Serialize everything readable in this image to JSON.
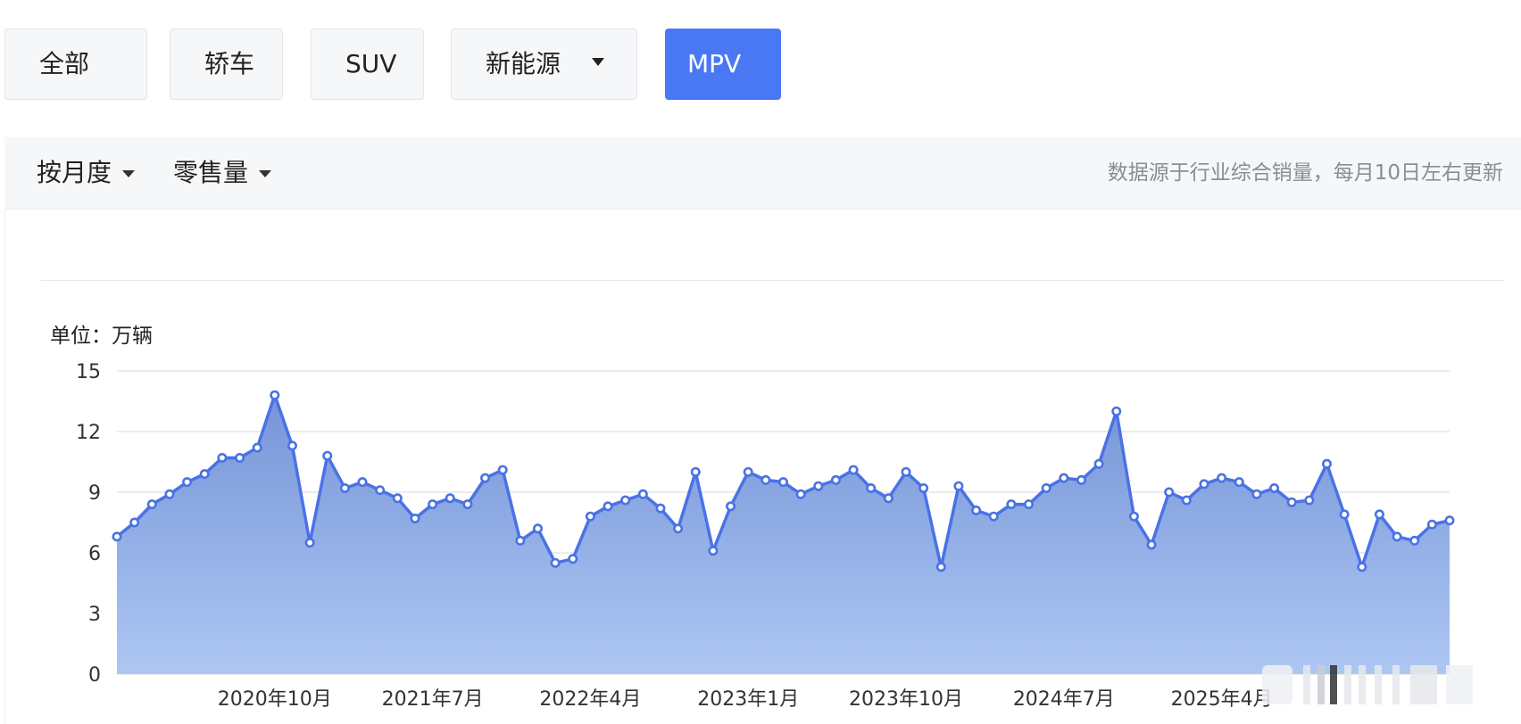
{
  "tabs": [
    {
      "label": "全部",
      "active": false,
      "dropdown": false
    },
    {
      "label": "轿车",
      "active": false,
      "dropdown": false
    },
    {
      "label": "SUV",
      "active": false,
      "dropdown": false
    },
    {
      "label": "新能源",
      "active": false,
      "dropdown": true
    },
    {
      "label": "MPV",
      "active": true,
      "dropdown": false
    }
  ],
  "filters": {
    "period": "按月度",
    "metric": "零售量",
    "source_note": "数据源于行业综合销量，每月10日左右更新"
  },
  "unit_label": "单位：万辆",
  "colors": {
    "accent": "#4a78f5",
    "line": "#4a72e6",
    "tab_bg": "#f6f7f8"
  },
  "chart_data": {
    "type": "area",
    "title": "",
    "xlabel": "",
    "ylabel": "",
    "y_unit": "万辆",
    "ylim": [
      0,
      15
    ],
    "yticks": [
      0,
      3,
      6,
      9,
      12,
      15
    ],
    "grid": true,
    "x_start": "2020年1月",
    "x_labeled_ticks": [
      {
        "index": 9,
        "label": "2020年10月"
      },
      {
        "index": 18,
        "label": "2021年7月"
      },
      {
        "index": 27,
        "label": "2022年4月"
      },
      {
        "index": 36,
        "label": "2023年1月"
      },
      {
        "index": 45,
        "label": "2023年10月"
      },
      {
        "index": 54,
        "label": "2024年7月"
      },
      {
        "index": 63,
        "label": "2025年4月"
      }
    ],
    "series": [
      {
        "name": "",
        "values": [
          6.8,
          7.5,
          8.4,
          8.9,
          9.5,
          9.9,
          10.7,
          10.7,
          11.2,
          13.8,
          11.3,
          6.5,
          10.8,
          9.2,
          9.5,
          9.1,
          8.7,
          7.7,
          8.4,
          8.7,
          8.4,
          9.7,
          10.1,
          6.6,
          7.2,
          5.5,
          5.7,
          7.8,
          8.3,
          8.6,
          8.9,
          8.2,
          7.2,
          10.0,
          6.1,
          8.3,
          10.0,
          9.6,
          9.5,
          8.9,
          9.3,
          9.6,
          10.1,
          9.2,
          8.7,
          10.0,
          9.2,
          5.3,
          9.3,
          8.1,
          7.8,
          8.4,
          8.4,
          9.2,
          9.7,
          9.6,
          10.4,
          13.0,
          7.8,
          6.4,
          9.0,
          8.6,
          9.4,
          9.7,
          9.5,
          8.9,
          9.2,
          8.5,
          8.6,
          10.4,
          7.9,
          5.3,
          7.9,
          6.8,
          6.6,
          7.4,
          7.6
        ]
      }
    ]
  }
}
